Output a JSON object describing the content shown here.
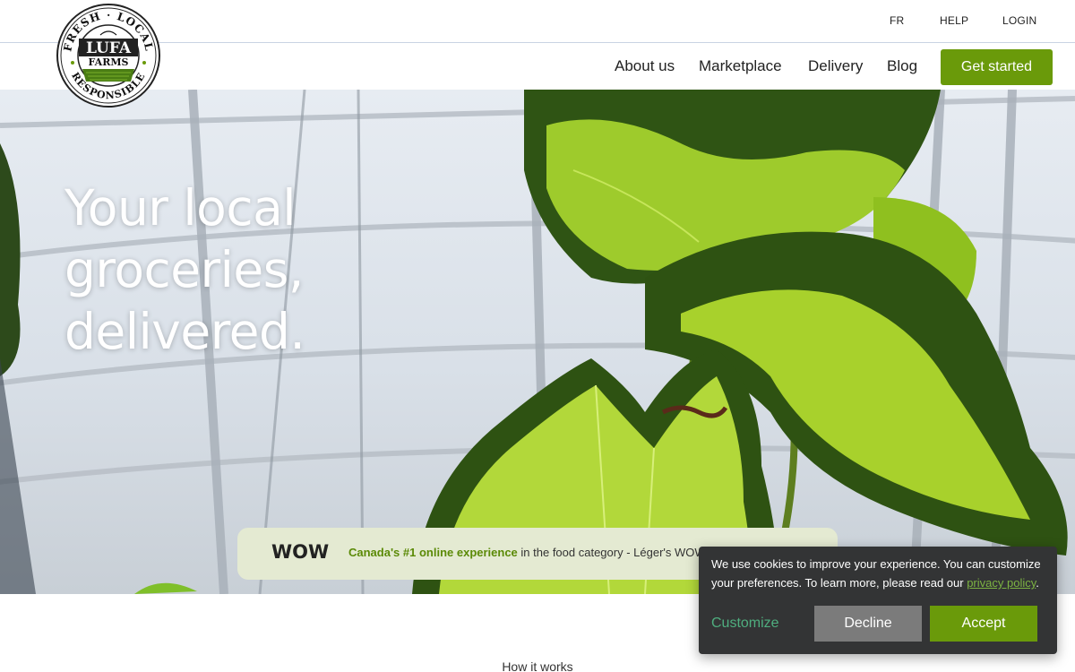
{
  "header": {
    "utility_links": [
      "FR",
      "HELP",
      "LOGIN"
    ],
    "nav_links": [
      "About us",
      "Marketplace",
      "Delivery",
      "Blog"
    ],
    "cta_label": "Get started"
  },
  "logo": {
    "top_arc": "FRESH · LOCAL",
    "bottom_arc": "RESPONSIBLE",
    "center_top": "LUFA",
    "center_bottom": "FARMS"
  },
  "hero": {
    "title_lines": [
      "Your local",
      "groceries,",
      "delivered."
    ]
  },
  "wow_bar": {
    "logo_text": "WOW",
    "highlight": "Canada's #1 online experience",
    "text": " in the food category - Léger's WOW"
  },
  "section": {
    "how_it_works": "How it works"
  },
  "cookie_banner": {
    "message": "We use cookies to improve your experience. You can customize your preferences. To learn more, please read our ",
    "link_text": "privacy policy",
    "message_end": ".",
    "customize_label": "Customize",
    "decline_label": "Decline",
    "accept_label": "Accept"
  },
  "colors": {
    "brand_green": "#6a9a0a",
    "cookie_bg": "#333435",
    "wow_bar_bg": "#e4ead2"
  }
}
